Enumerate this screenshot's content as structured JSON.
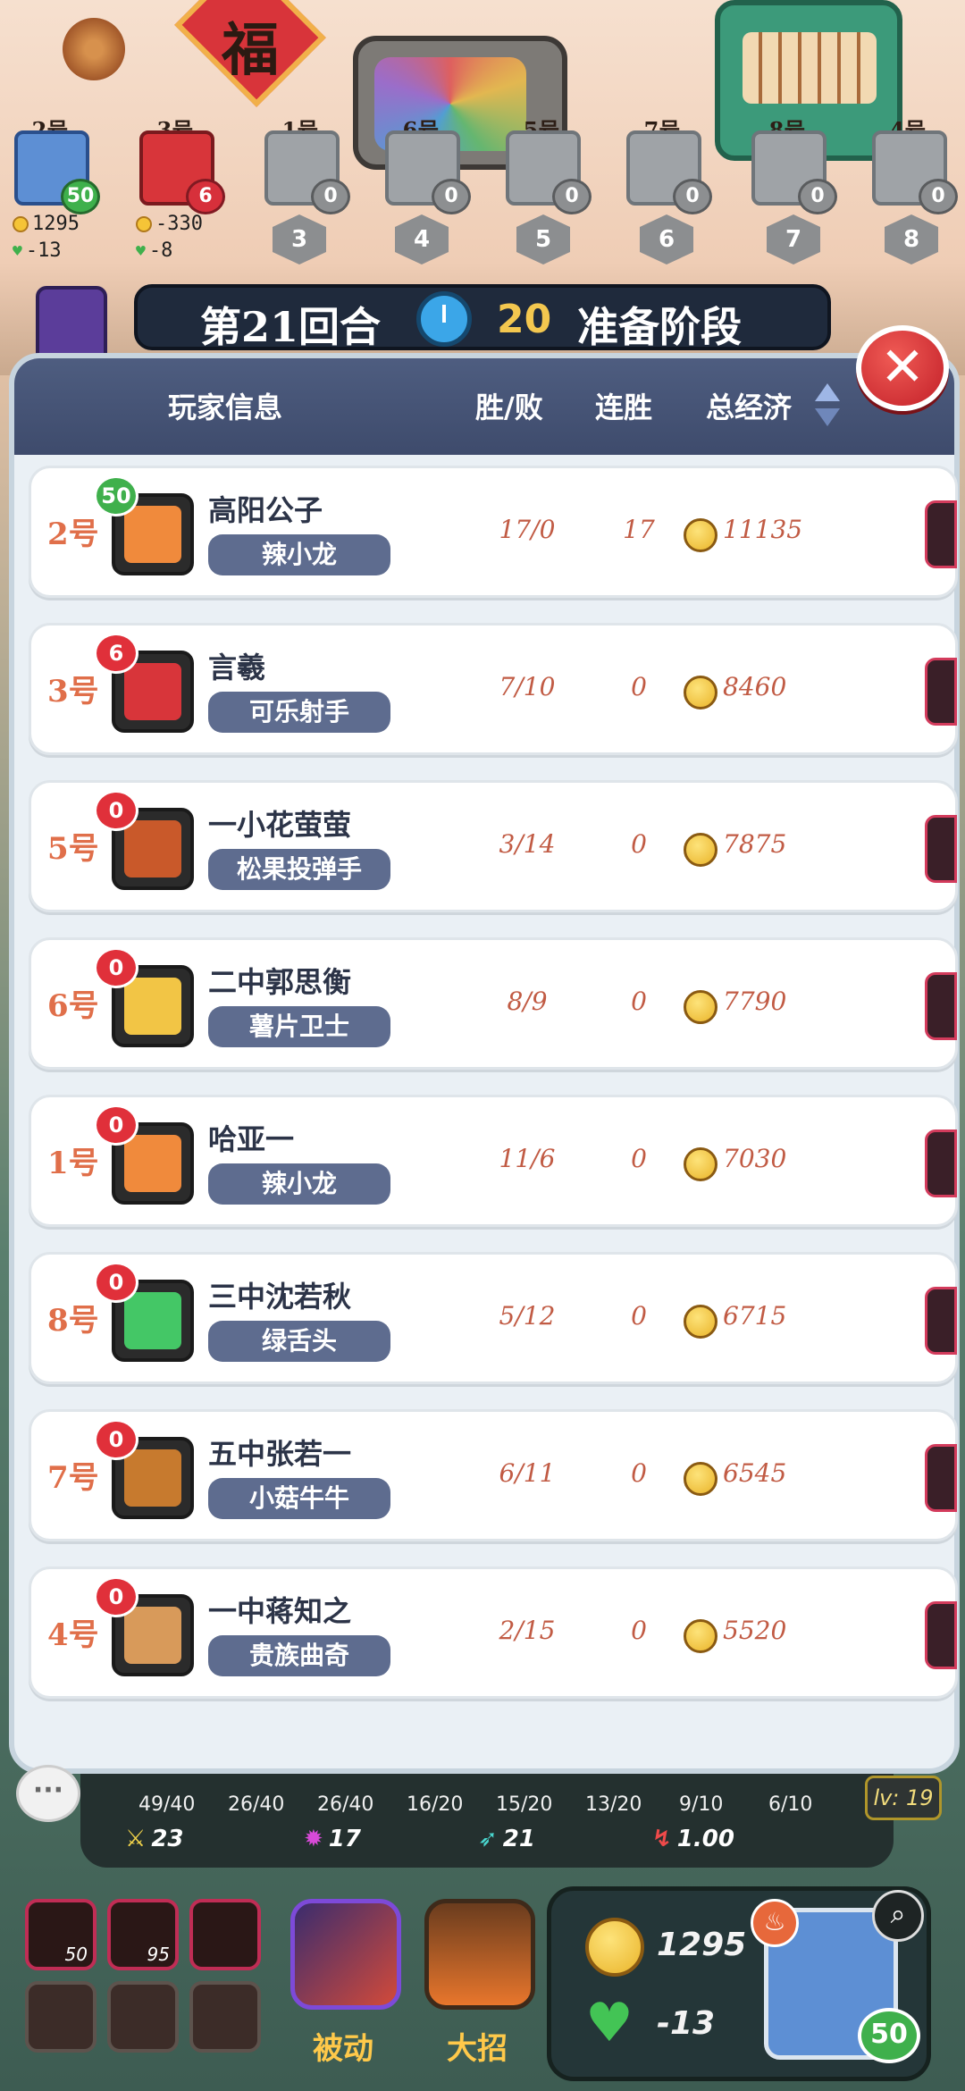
{
  "scene": {
    "fu": "福",
    "players": [
      {
        "num": "2号",
        "hp": "50",
        "hp_color": "green",
        "active": true
      },
      {
        "num": "3号",
        "hp": "6",
        "hp_color": "red",
        "active": true
      },
      {
        "num": "1号",
        "hp": "0",
        "hp_color": "grey",
        "active": false
      },
      {
        "num": "6号",
        "hp": "0",
        "hp_color": "grey",
        "active": false
      },
      {
        "num": "5号",
        "hp": "0",
        "hp_color": "grey",
        "active": false
      },
      {
        "num": "7号",
        "hp": "0",
        "hp_color": "grey",
        "active": false
      },
      {
        "num": "8号",
        "hp": "0",
        "hp_color": "grey",
        "active": false
      },
      {
        "num": "4号",
        "hp": "0",
        "hp_color": "grey",
        "active": false
      }
    ],
    "p1_coins": "1295",
    "p1_hp_delta": "-13",
    "p2_coins": "-330",
    "p2_hp_delta": "-8",
    "badges": [
      "3",
      "4",
      "5",
      "6",
      "7",
      "8"
    ]
  },
  "round": {
    "label": "第21回合",
    "timer": "20",
    "phase": "准备阶段",
    "close": "✕"
  },
  "panel": {
    "headers": {
      "player": "玩家信息",
      "wl": "胜/败",
      "streak": "连胜",
      "economy": "总经济"
    },
    "rows": [
      {
        "num": "2号",
        "hp": "50",
        "hp_color": "green",
        "name": "高阳公子",
        "hero": "辣小龙",
        "wl": "17/0",
        "streak": "17",
        "econ": "11135",
        "av": "#f08a3c"
      },
      {
        "num": "3号",
        "hp": "6",
        "hp_color": "red",
        "name": "言羲",
        "hero": "可乐射手",
        "wl": "7/10",
        "streak": "0",
        "econ": "8460",
        "av": "#d8353a"
      },
      {
        "num": "5号",
        "hp": "0",
        "hp_color": "red",
        "name": "一小花萤萤",
        "hero": "松果投弹手",
        "wl": "3/14",
        "streak": "0",
        "econ": "7875",
        "av": "#c9592a"
      },
      {
        "num": "6号",
        "hp": "0",
        "hp_color": "red",
        "name": "二中郭思衡",
        "hero": "薯片卫士",
        "wl": "8/9",
        "streak": "0",
        "econ": "7790",
        "av": "#f2c545"
      },
      {
        "num": "1号",
        "hp": "0",
        "hp_color": "red",
        "name": "哈亚一",
        "hero": "辣小龙",
        "wl": "11/6",
        "streak": "0",
        "econ": "7030",
        "av": "#f08a3c"
      },
      {
        "num": "8号",
        "hp": "0",
        "hp_color": "red",
        "name": "三中沈若秋",
        "hero": "绿舌头",
        "wl": "5/12",
        "streak": "0",
        "econ": "6715",
        "av": "#44c766"
      },
      {
        "num": "7号",
        "hp": "0",
        "hp_color": "red",
        "name": "五中张若一",
        "hero": "小菇牛牛",
        "wl": "6/11",
        "streak": "0",
        "econ": "6545",
        "av": "#c77a2e"
      },
      {
        "num": "4号",
        "hp": "0",
        "hp_color": "red",
        "name": "一中蒋知之",
        "hero": "贵族曲奇",
        "wl": "2/15",
        "streak": "0",
        "econ": "5520",
        "av": "#d89a5a"
      }
    ]
  },
  "hud": {
    "chat": "···",
    "progress": [
      "49/40",
      "26/40",
      "26/40",
      "16/20",
      "15/20",
      "13/20",
      "9/10",
      "6/10"
    ],
    "stats": [
      {
        "icon": "sword-icon",
        "sym": "⚔",
        "color": "#f1d34a",
        "value": "23"
      },
      {
        "icon": "burst-icon",
        "sym": "✹",
        "color": "#d84ad8",
        "value": "17"
      },
      {
        "icon": "boot-icon",
        "sym": "➶",
        "color": "#4ad8d0",
        "value": "21"
      },
      {
        "icon": "lightning-icon",
        "sym": "↯",
        "color": "#ef4a4a",
        "value": "1.00"
      }
    ],
    "level": "lv: 19",
    "items": [
      {
        "count": "50"
      },
      {
        "count": "95"
      },
      {
        "count": ""
      }
    ],
    "skill_passive": "被动",
    "skill_ult": "大招",
    "coins": "1295",
    "hp_delta": "-13",
    "hero_hp": "50"
  },
  "colors": {
    "accent_red": "#e0303a",
    "header_blue": "#4e5d80",
    "value_orange": "#c15b44"
  }
}
